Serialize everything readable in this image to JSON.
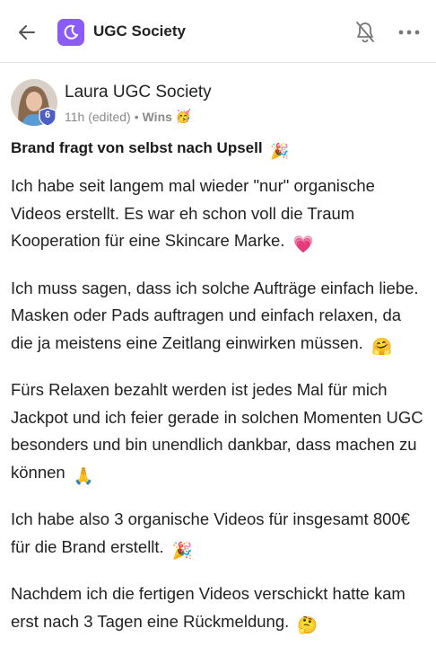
{
  "header": {
    "back_icon": "arrow-left-icon",
    "community_icon": "moon-logo-icon",
    "community_name": "UGC Society",
    "notify_icon": "bell-off-icon",
    "more_icon": "more-horizontal-icon",
    "accent": "#8b5cf6"
  },
  "post": {
    "author": "Laura UGC Society",
    "level": "6",
    "time": "11h (edited)",
    "separator": "•",
    "space": "Wins",
    "space_emoji": "🥳",
    "title": "Brand fragt von selbst nach Upsell",
    "title_emoji": "🎉",
    "paragraphs": [
      {
        "text": "Ich habe seit langem mal wieder \"nur\" organische Videos erstellt. Es war eh schon voll die Traum Kooperation für eine Skincare Marke.",
        "emoji": "💗"
      },
      {
        "text": "Ich muss sagen, dass ich solche Aufträge einfach liebe. Masken oder Pads auftragen und einfach relaxen, da die ja meistens eine Zeitlang einwirken müssen.",
        "emoji": "🤗"
      },
      {
        "text": "Fürs Relaxen bezahlt werden ist jedes Mal für mich Jackpot und ich feier gerade in solchen Momenten UGC besonders und bin unendlich dankbar, dass machen zu können",
        "emoji": "🙏"
      },
      {
        "text": "Ich habe also 3 organische Videos für insgesamt 800€ für die Brand erstellt.",
        "emoji": "🎉"
      },
      {
        "text": "Nachdem ich die fertigen Videos verschickt hatte kam erst nach 3 Tagen eine Rückmeldung.",
        "emoji": "🤔"
      }
    ]
  }
}
